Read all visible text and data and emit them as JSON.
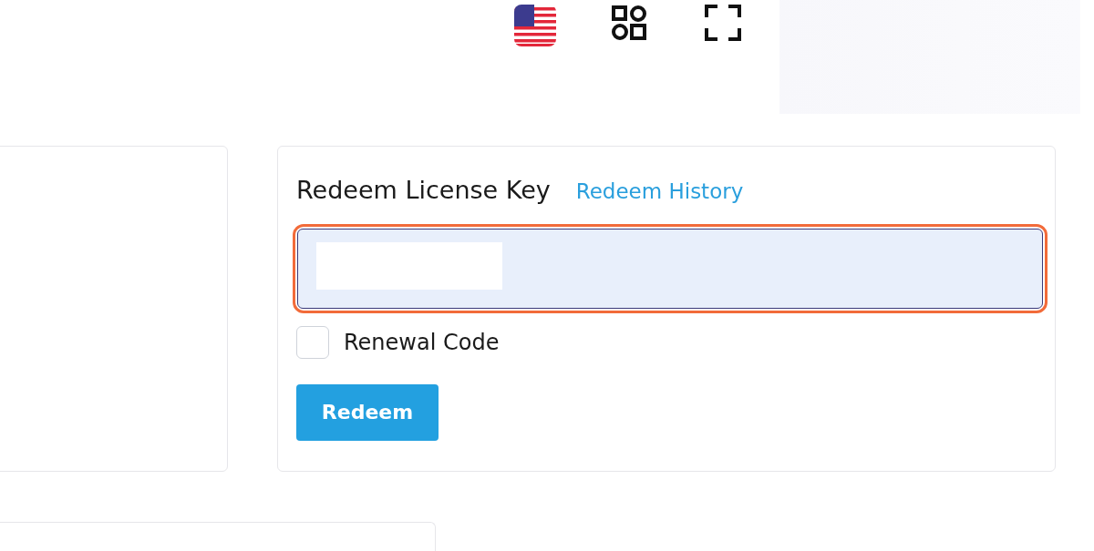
{
  "redeem_card": {
    "title": "Redeem License Key",
    "history_link": "Redeem History",
    "license_field": {
      "highlighted": true,
      "redacted": true
    },
    "renewal_checkbox": {
      "label": "Renewal Code",
      "checked": false
    },
    "submit_button": "Redeem"
  }
}
